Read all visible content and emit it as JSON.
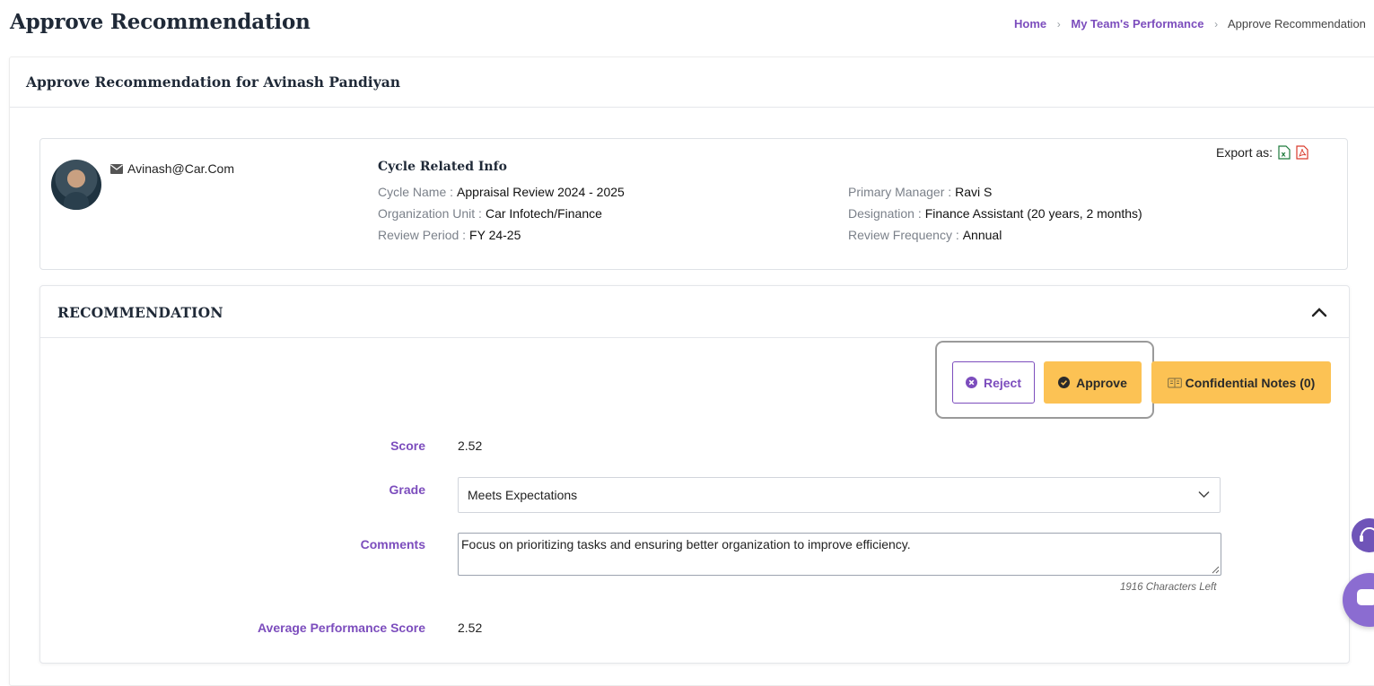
{
  "page": {
    "title": "Approve Recommendation"
  },
  "breadcrumb": {
    "home": "Home",
    "team": "My Team's Performance",
    "current": "Approve Recommendation"
  },
  "card": {
    "title": "Approve Recommendation for Avinash Pandiyan"
  },
  "employee": {
    "email": "Avinash@Car.Com",
    "avatar_icon": "avatar-photo"
  },
  "cycle": {
    "title": "Cycle Related Info",
    "fields": [
      {
        "label": "Cycle Name :",
        "value": "Appraisal Review 2024 - 2025"
      },
      {
        "label": "Organization Unit :",
        "value": "Car Infotech/Finance"
      },
      {
        "label": "Review Period :",
        "value": "FY 24-25"
      },
      {
        "label": "Primary Manager :",
        "value": "Ravi S"
      },
      {
        "label": "Designation :",
        "value": "Finance Assistant (20 years, 2 months)"
      },
      {
        "label": "Review Frequency :",
        "value": "Annual"
      }
    ]
  },
  "export": {
    "label": "Export as:",
    "icons": [
      "excel-icon",
      "pdf-icon"
    ]
  },
  "recommendation": {
    "title": "RECOMMENDATION",
    "buttons": {
      "reject": "Reject",
      "approve": "Approve",
      "notes": "Confidential Notes (0)"
    },
    "score_label": "Score",
    "score_value": "2.52",
    "grade_label": "Grade",
    "grade_value": "Meets Expectations",
    "comments_label": "Comments",
    "comments_value": "Focus on prioritizing tasks and ensuring better organization to improve efficiency.",
    "chars_left": "1916 Characters Left",
    "avg_label": "Average Performance Score",
    "avg_value": "2.52"
  },
  "colors": {
    "accent": "#7c4dbd",
    "button_yellow": "#fcc254",
    "chat": "#8b6cd1"
  }
}
